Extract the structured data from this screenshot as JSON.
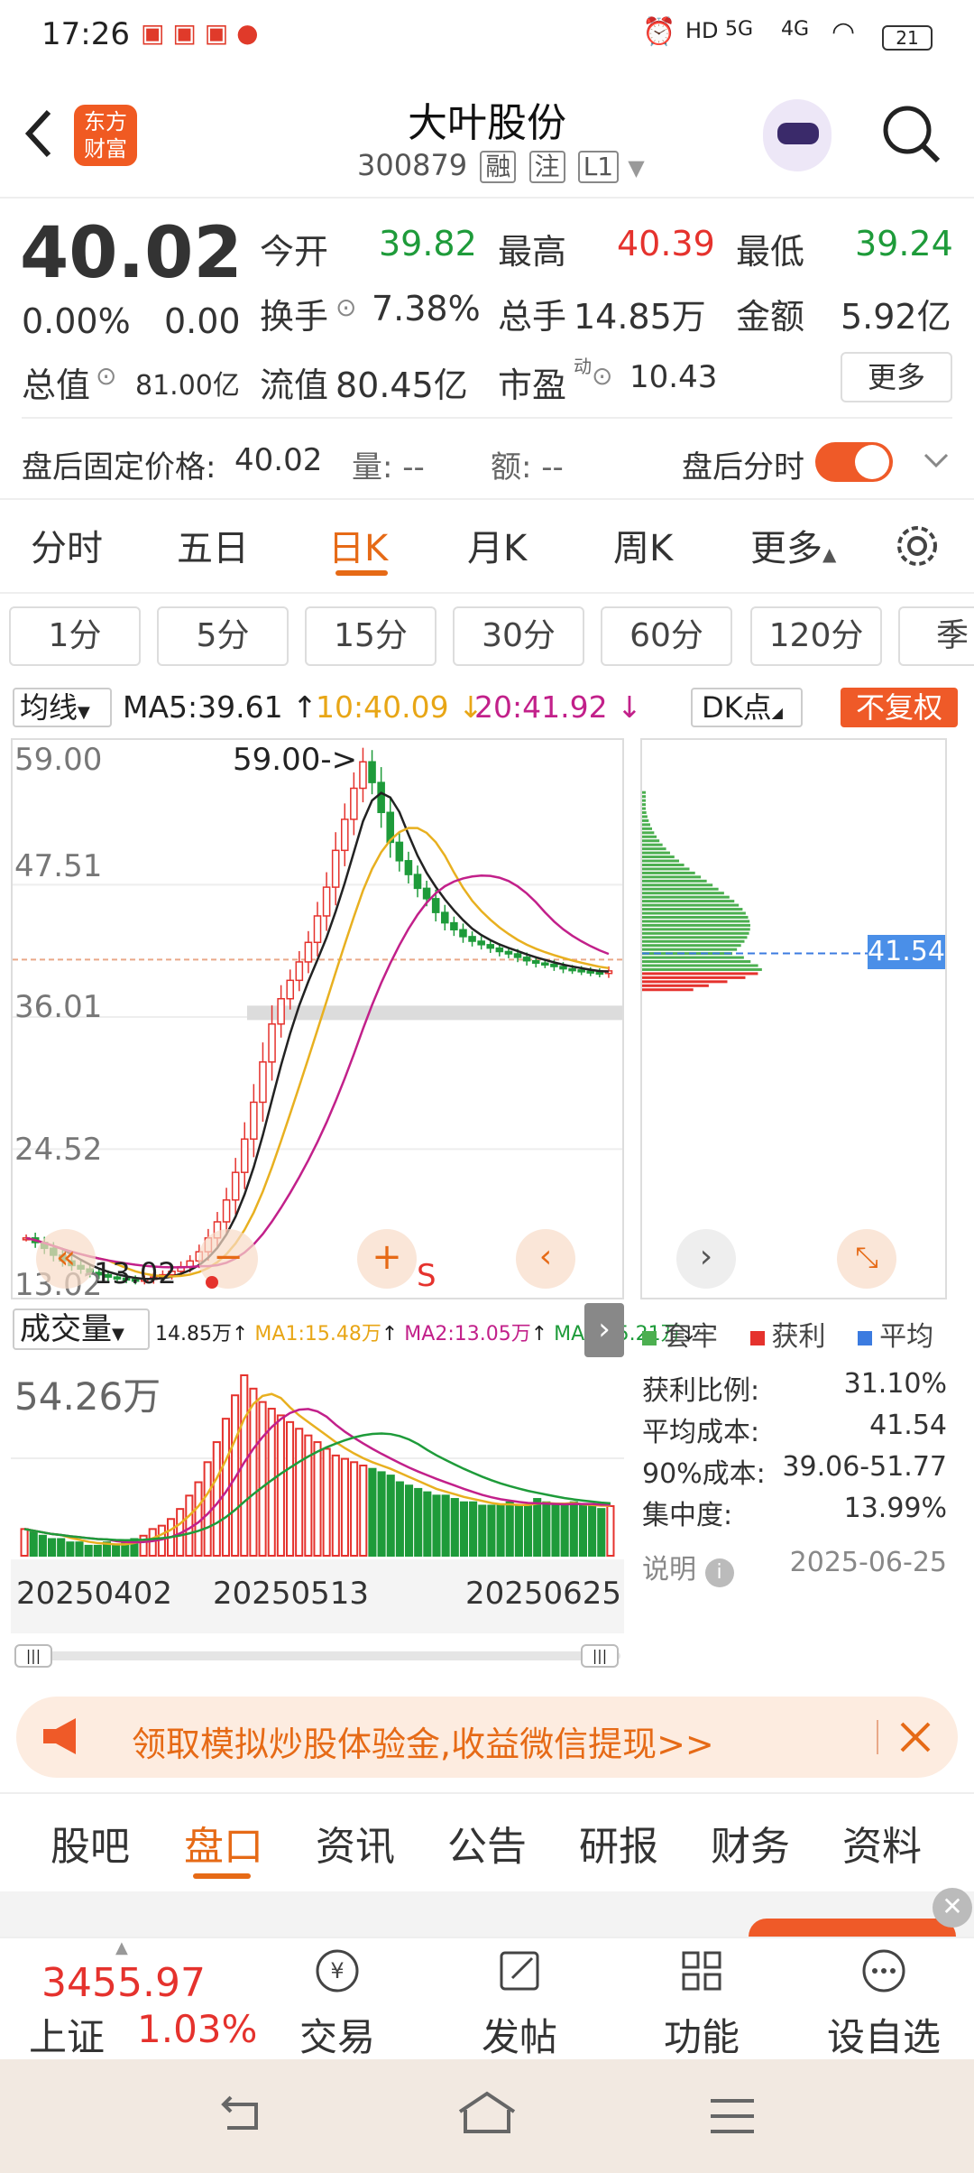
{
  "status": {
    "time": "17:26",
    "battery": "21",
    "net1": "5G",
    "net2": "4G"
  },
  "header": {
    "brand_line1": "东方",
    "brand_line2": "财富",
    "title": "大叶股份",
    "code": "300879",
    "tags": [
      "融",
      "注",
      "L1"
    ]
  },
  "quote": {
    "price": "40.02",
    "change_pct": "0.00%",
    "change": "0.00",
    "open_label": "今开",
    "open": "39.82",
    "high_label": "最高",
    "high": "40.39",
    "low_label": "最低",
    "low": "39.24",
    "turnover_label": "换手",
    "turnover": "7.38%",
    "volume_label": "总手",
    "volume": "14.85万",
    "amount_label": "金额",
    "amount": "5.92亿",
    "mktcap_label": "总值",
    "mktcap": "81.00亿",
    "float_label": "流值",
    "float": "80.45亿",
    "pe_label": "市盈",
    "pe_sup": "动",
    "pe": "10.43",
    "more": "更多"
  },
  "afterhours": {
    "price_label": "盘后固定价格:",
    "price": "40.02",
    "vol_label": "量: --",
    "amt_label": "额: --",
    "toggle_label": "盘后分时",
    "toggle_on": true
  },
  "tabs": [
    "分时",
    "五日",
    "日K",
    "月K",
    "周K",
    "更多"
  ],
  "active_tab": "日K",
  "periods": [
    "1分",
    "5分",
    "15分",
    "30分",
    "60分",
    "120分",
    "季"
  ],
  "ma_bar": {
    "select": "均线",
    "ma5": "MA5:39.61",
    "ma10": "10:40.09",
    "ma20": "20:41.92",
    "dk": "DK点",
    "fq": "不复权"
  },
  "chart_data": {
    "type": "candlestick",
    "y_ticks": [
      "59.00",
      "47.51",
      "36.01",
      "24.52",
      "13.02"
    ],
    "ylim": [
      13.02,
      59.0
    ],
    "annotations": [
      "59.00->",
      "13.02"
    ],
    "x_labels": [
      "20250402",
      "20250513",
      "20250625"
    ],
    "volume_title": "成交量",
    "volume_max": "54.26万",
    "volume_legend": [
      "14.85万",
      "MA1:15.48万",
      "MA2:13.05万",
      "MA3:15.21万"
    ],
    "chip_price": "41.54",
    "closes": [
      16.8,
      16.4,
      15.9,
      15.3,
      14.8,
      14.4,
      14.1,
      13.8,
      13.6,
      13.4,
      13.3,
      13.2,
      13.1,
      13.2,
      13.4,
      13.6,
      13.9,
      14.3,
      14.8,
      15.6,
      16.8,
      18.2,
      20.1,
      22.5,
      25.4,
      28.6,
      32.1,
      35.4,
      37.6,
      39.2,
      40.8,
      42.5,
      44.8,
      47.3,
      50.5,
      53.2,
      55.9,
      58.2,
      56.4,
      53.8,
      51.2,
      49.6,
      48.4,
      47.2,
      46.3,
      45.1,
      44.2,
      43.6,
      43.0,
      42.6,
      42.3,
      42.0,
      41.7,
      41.5,
      41.2,
      40.9,
      40.7,
      40.6,
      40.4,
      40.2,
      40.1,
      40.0,
      39.9,
      39.8,
      40.02
    ],
    "volumes": [
      8,
      7,
      6,
      5,
      5,
      4,
      4,
      3,
      3,
      4,
      3,
      4,
      5,
      6,
      8,
      9,
      11,
      14,
      18,
      22,
      28,
      34,
      41,
      48,
      54,
      50,
      46,
      44,
      42,
      40,
      38,
      36,
      34,
      32,
      30,
      29,
      28,
      27,
      26,
      25,
      24,
      22,
      21,
      20,
      19,
      18,
      18,
      17,
      16,
      16,
      15,
      15,
      15,
      16,
      15,
      15,
      17,
      16,
      15,
      15,
      16,
      15,
      15,
      14,
      14.85
    ]
  },
  "chip_panel": {
    "legend": [
      "套牢",
      "获利",
      "平均"
    ],
    "rows": [
      {
        "label": "获利比例:",
        "value": "31.10%"
      },
      {
        "label": "平均成本:",
        "value": "41.54"
      },
      {
        "label": "90%成本:",
        "value": "39.06-51.77"
      },
      {
        "label": "集中度:",
        "value": "13.99%"
      }
    ],
    "note_label": "说明",
    "date": "2025-06-25"
  },
  "banner": {
    "text": "领取模拟炒股体验金,收益微信提现>>"
  },
  "bottom_tabs": [
    "股吧",
    "盘口",
    "资讯",
    "公告",
    "研报",
    "财务",
    "资料"
  ],
  "active_bottom_tab": "盘口",
  "index": {
    "value": "3455.97",
    "name": "上证",
    "pct": "1.03%"
  },
  "nav": [
    "交易",
    "发帖",
    "功能",
    "设自选"
  ],
  "colors": {
    "up": "#e5322d",
    "down": "#1e9b3a",
    "accent": "#ef5a28"
  }
}
